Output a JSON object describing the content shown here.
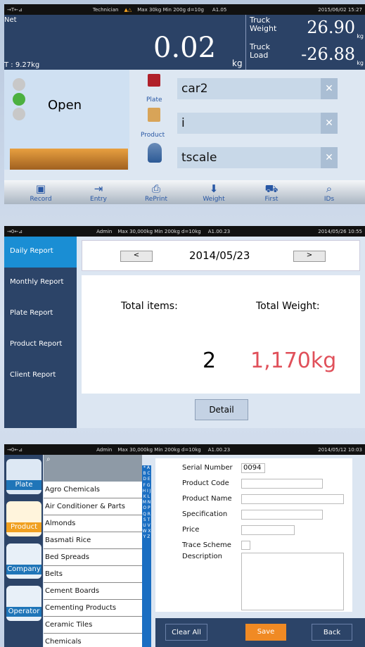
{
  "panel1": {
    "status": {
      "left": "→T←⊿",
      "user": "Technician",
      "alert_icon": "warning-icon",
      "limits": "Max 30kg  Min 200g  d=10g",
      "version": "A1.05",
      "datetime": "2015/06/02 15:27"
    },
    "net_label": "Net",
    "tare": "T :   9.27kg",
    "weight": "0.02",
    "unit": "kg",
    "truck_weight_label": "Truck\nWeight",
    "truck_weight": "26.90",
    "truck_weight_unit": "kg",
    "truck_load_label": "Truck\nLoad",
    "truck_load": "-26.88",
    "truck_load_unit": "kg",
    "gate_status": "Open",
    "fields": [
      {
        "icon": "plate-icon",
        "label": "Plate",
        "value": "car2"
      },
      {
        "icon": "product-icon",
        "label": "Product",
        "value": "i"
      },
      {
        "icon": "user-icon",
        "label": "",
        "value": "tscale"
      }
    ],
    "toolbar": [
      "Record",
      "Entry",
      "RePrint",
      "Weight",
      "First",
      "IDs"
    ]
  },
  "panel2": {
    "status": {
      "left": "→0←⊿",
      "user": "Admin",
      "limits": "Max 30,000kg  Min 200kg  d=10kg",
      "version": "A1.00.23",
      "datetime": "2014/05/26  10:55"
    },
    "menu": [
      "Daily Report",
      "Monthly Report",
      "Plate Report",
      "Product Report",
      "Client Report"
    ],
    "prev": "<",
    "next": ">",
    "date": "2014/05/23",
    "total_items_label": "Total items:",
    "total_weight_label": "Total Weight:",
    "total_items": "2",
    "total_weight": "1,170kg",
    "detail": "Detail"
  },
  "panel3": {
    "status": {
      "left": "→0←⊿",
      "user": "Admin",
      "limits": "Max 30,000kg  Min 200kg  d=10kg",
      "version": "A1.00.23",
      "datetime": "2014/05/12  10:03"
    },
    "categories": [
      "Plate",
      "Product",
      "Company",
      "Operator"
    ],
    "items": [
      "Agro Chemicals",
      "Air Conditioner & Parts",
      "Almonds",
      "Basmati Rice",
      "Bed Spreads",
      "Belts",
      "Cement Boards",
      "Cementing Products",
      "Ceramic Tiles",
      "Chemicals"
    ],
    "alphabet": "* A B C D E F G H I J K L M N O P Q R S T U V W X Y Z",
    "form": {
      "serial_label": "Serial Number",
      "serial": "0094",
      "code_label": "Product Code",
      "name_label": "Product Name",
      "spec_label": "Specification",
      "price_label": "Price",
      "trace_label": "Trace Scheme",
      "desc_label": "Description"
    },
    "buttons": {
      "clear": "Clear All",
      "save": "Save",
      "back": "Back"
    },
    "colors": {
      "save": "#f08a24",
      "nav": "#2c4468",
      "accent": "#1a8ed4",
      "weight_red": "#e0505a"
    }
  }
}
